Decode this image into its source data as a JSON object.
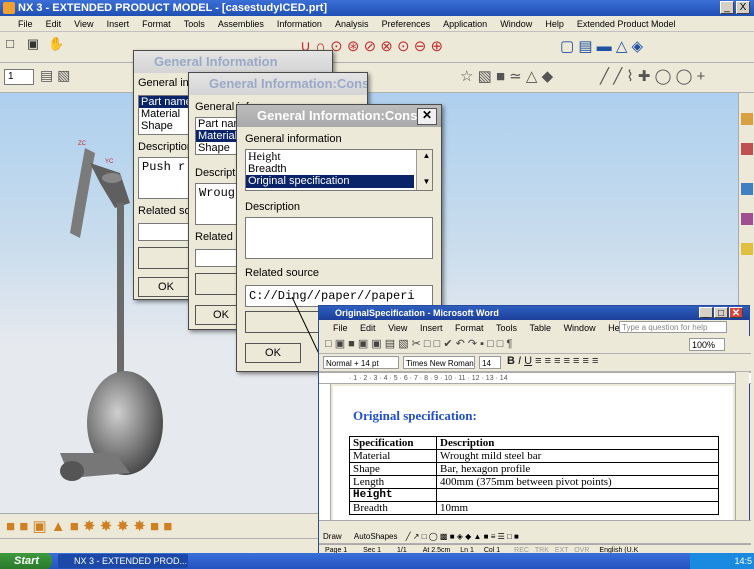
{
  "nx": {
    "title": "NX 3 - EXTENDED PRODUCT MODEL - [casestudyICED.prt]",
    "menu": [
      "File",
      "Edit",
      "View",
      "Insert",
      "Format",
      "Tools",
      "Assemblies",
      "Information",
      "Analysis",
      "Preferences",
      "Application",
      "Window",
      "Help",
      "Extended Product Model"
    ],
    "layer_value": "1",
    "window_controls": [
      "_",
      "□",
      "X"
    ]
  },
  "dialog1": {
    "title": "General Information",
    "section_label": "General inf",
    "list": [
      "Part name",
      "Material",
      "Shape"
    ],
    "selected_index": 0,
    "description_label": "Description",
    "description_value": "Push r",
    "related_label": "Related sou",
    "ok_label": "OK"
  },
  "dialog2": {
    "title": "General Information:Const...",
    "section_label": "General inf",
    "list": [
      "Part nan",
      "Material",
      "Shape"
    ],
    "selected_index": 1,
    "description_label": "Descriptic",
    "description_value": "Wroug",
    "related_label": "Related s",
    "ok_label": "OK"
  },
  "dialog3": {
    "title": "General Information:Const...",
    "section_label": "General information",
    "list": [
      "Height",
      "Breadth",
      "Original specification"
    ],
    "selected_index": 2,
    "description_label": "Description",
    "description_value": "",
    "related_label": "Related source",
    "related_value": "C://Ding//paper//paperi",
    "ok_label": "OK"
  },
  "word": {
    "title": "OriginalSpecification - Microsoft Word",
    "menu": [
      "File",
      "Edit",
      "View",
      "Insert",
      "Format",
      "Tools",
      "Table",
      "Window",
      "Help"
    ],
    "help_placeholder": "Type a question for help",
    "zoom": "100%",
    "style": "Normal + 14 pt",
    "font": "Times New Roman",
    "font_size": "14",
    "heading": "Original specification:",
    "table_headers": [
      "Specification",
      "Description"
    ],
    "table_rows": [
      [
        "Material",
        "Wrought mild steel bar"
      ],
      [
        "Shape",
        "Bar, hexagon profile"
      ],
      [
        "Length",
        "400mm (375mm between pivot  points)"
      ],
      [
        "Height",
        ""
      ],
      [
        "Breadth",
        "10mm"
      ]
    ],
    "draw_label": "Draw",
    "autoshapes_label": "AutoShapes",
    "status": [
      "Page 1",
      "Sec 1",
      "1/1",
      "At 2.5cm",
      "Ln 1",
      "Col 1",
      "REC",
      "TRK",
      "EXT",
      "OVR",
      "English (U.K"
    ]
  },
  "taskbar": {
    "start_label": "Start",
    "task_label": "NX 3 - EXTENDED PROD...",
    "clock": "14:5"
  },
  "colors": {
    "viewport_top": "#aed0ee",
    "viewport_bottom": "#e6e9ee",
    "selection": "#0a246a",
    "heading_blue": "#1f4fd0"
  }
}
